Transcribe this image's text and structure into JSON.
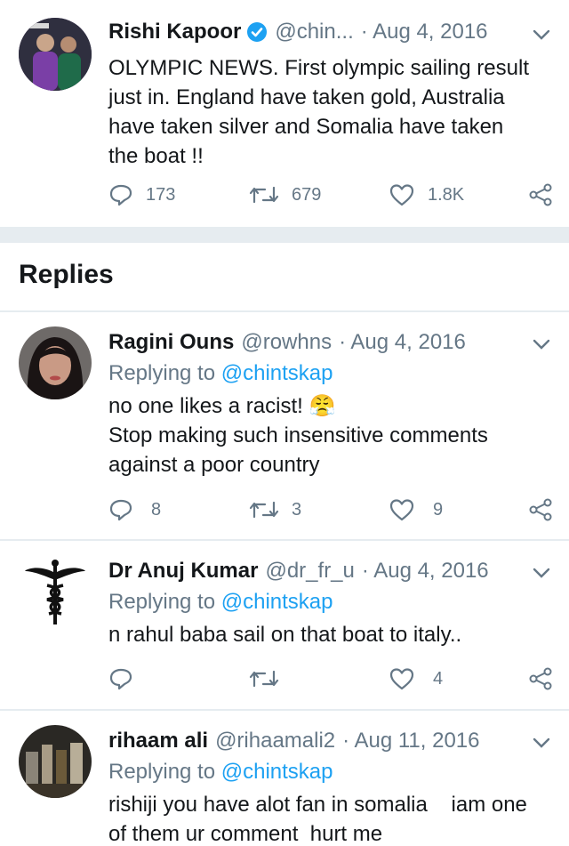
{
  "main_tweet": {
    "name": "Rishi Kapoor",
    "handle": "@chin...",
    "date": "· Aug 4, 2016",
    "lines": [
      "OLYMPIC NEWS. First olympic sailing result",
      "just in. England have taken gold, Australia",
      "have taken silver and Somalia have taken",
      "the boat !!"
    ],
    "replies": "173",
    "retweets": "679",
    "likes": "1.8K"
  },
  "section_title": "Replies",
  "replies": [
    {
      "name": "Ragini Ouns",
      "handle": "@rowhns",
      "date": "· Aug 4, 2016",
      "replying_prefix": "Replying to",
      "replying_handle": "@chintskap",
      "lines": [
        "no one likes a racist! 😤",
        "Stop making such insensitive comments",
        "against a poor country"
      ],
      "replies": "8",
      "retweets": "3",
      "likes": "9"
    },
    {
      "name": "Dr Anuj Kumar",
      "handle": "@dr_fr_u",
      "date": "· Aug 4, 2016",
      "replying_prefix": "Replying to",
      "replying_handle": "@chintskap",
      "lines": [
        "n rahul baba sail on that boat to italy.."
      ],
      "replies": "",
      "retweets": "",
      "likes": "4"
    },
    {
      "name": "rihaam ali",
      "handle": "@rihaamali2",
      "date": "· Aug 11, 2016",
      "replying_prefix": "Replying to",
      "replying_handle": "@chintskap",
      "lines": [
        "rishiji you have alot fan in somalia    iam one",
        "of them ur comment  hurt me"
      ]
    }
  ],
  "colors": {
    "link": "#1da1f2",
    "secondary": "#657786",
    "divider": "#e6ecf0",
    "verified": "#1da1f2"
  }
}
